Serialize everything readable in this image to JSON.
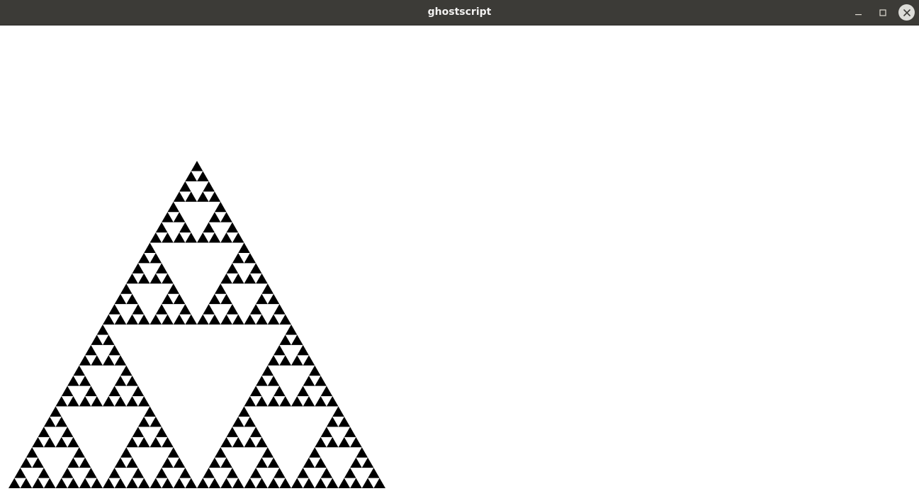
{
  "window": {
    "title": "ghostscript"
  },
  "controls": {
    "minimize_icon": "minimize-icon",
    "maximize_icon": "maximize-icon",
    "close_icon": "close-icon"
  },
  "colors": {
    "titlebar": "#3c3b37",
    "title_text": "#f2f1f0",
    "fractal_fill": "#000000",
    "canvas_bg": "#ffffff"
  },
  "content": {
    "figure": "sierpinski-triangle",
    "depth": 5
  }
}
